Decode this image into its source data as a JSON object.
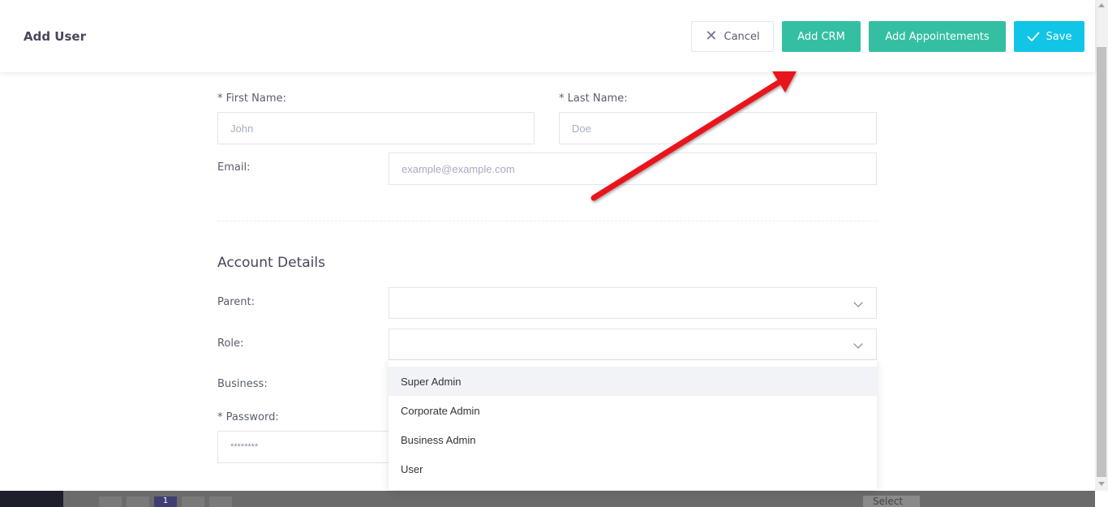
{
  "header": {
    "title": "Add User",
    "cancel_label": "Cancel",
    "add_crm_label": "Add CRM",
    "add_appointments_label": "Add Appointements",
    "save_label": "Save"
  },
  "form": {
    "first_name_label": "* First Name:",
    "first_name_placeholder": "John",
    "last_name_label": "* Last Name:",
    "last_name_placeholder": "Doe",
    "email_label": "Email:",
    "email_placeholder": "example@example.com",
    "section_title": "Account Details",
    "parent_label": "Parent:",
    "parent_value": "",
    "role_label": "Role:",
    "role_value": "",
    "business_label": "Business:",
    "password_label": "* Password:",
    "password_placeholder": "********"
  },
  "role_dropdown": {
    "options": [
      "Super Admin",
      "Corporate Admin",
      "Business Admin",
      "User"
    ],
    "highlighted": "Super Admin"
  },
  "footer": {
    "page_current": "1",
    "select_label": "Select"
  },
  "colors": {
    "primary_green": "#34bfa3",
    "save_cyan": "#11c5e6",
    "annotation_arrow": "#e8141a"
  }
}
